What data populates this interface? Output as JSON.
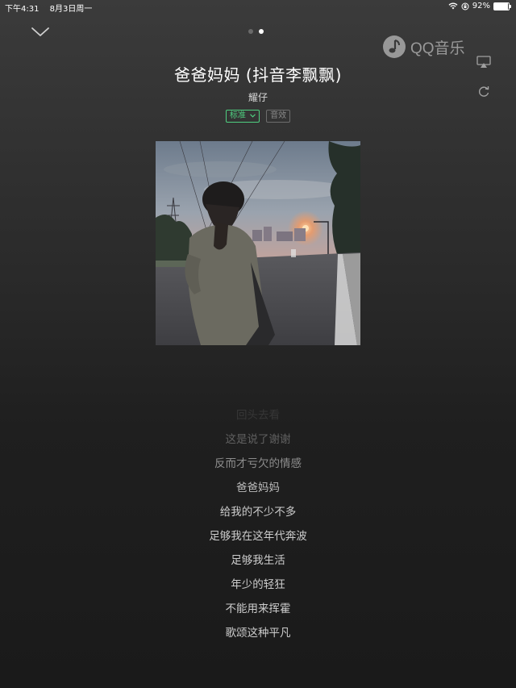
{
  "status_bar": {
    "time": "下午4:31",
    "date": "8月3日周一",
    "battery_pct": "92%",
    "battery_level": 0.92
  },
  "header": {
    "collapse_icon": "chevron-down-icon",
    "page_count": 2,
    "active_page": 2,
    "logo_text": "QQ音乐",
    "airplay_icon": "airplay-icon",
    "loop_icon": "loop-icon"
  },
  "song": {
    "title": "爸爸妈妈 (抖音李飘飘)",
    "artist": "耀仔",
    "quality_label": "标准",
    "sound_label": "音效"
  },
  "colors": {
    "accent_green": "#4fcf80",
    "background_top": "#3b3b3b",
    "background_bottom": "#1a1a1a"
  },
  "lyrics": [
    {
      "text": "回头去看",
      "opacity": 0.12
    },
    {
      "text": "这是说了谢谢",
      "opacity": 0.35
    },
    {
      "text": "反而才亏欠的情感",
      "opacity": 0.6
    },
    {
      "text": "爸爸妈妈",
      "opacity": 0.85
    },
    {
      "text": "给我的不少不多",
      "opacity": 0.95
    },
    {
      "text": "足够我在这年代奔波",
      "opacity": 0.95
    },
    {
      "text": "足够我生活",
      "opacity": 0.95
    },
    {
      "text": "年少的轻狂",
      "opacity": 0.95
    },
    {
      "text": "不能用来挥霍",
      "opacity": 0.95
    },
    {
      "text": "歌颂这种平凡",
      "opacity": 0.95
    }
  ]
}
